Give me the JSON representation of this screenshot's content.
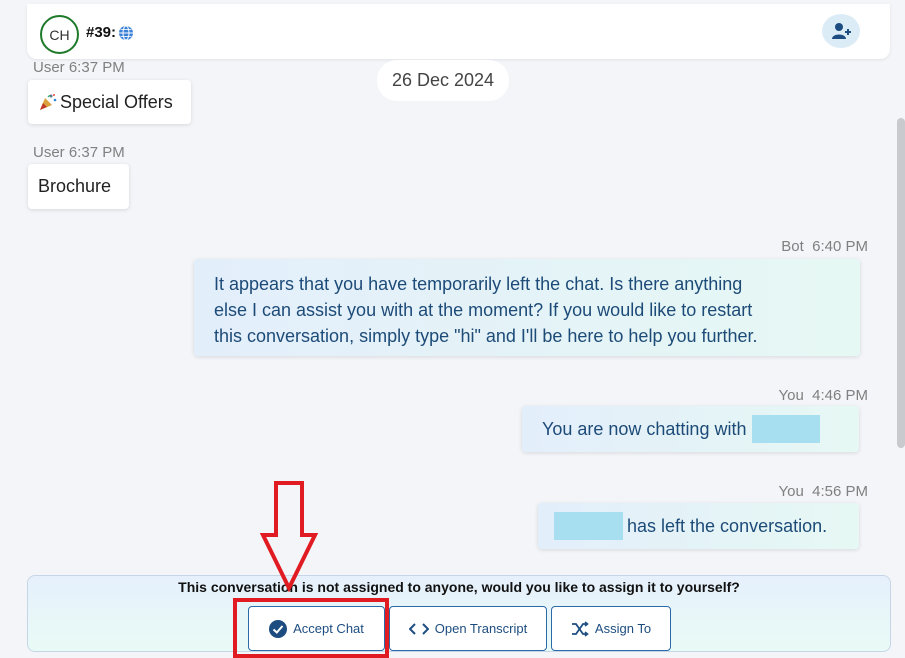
{
  "header": {
    "avatar_initials": "CH",
    "conversation_id": "#39:",
    "channel_icon": "globe-icon",
    "add_user_icon": "user-plus-icon"
  },
  "date_separator": "26 Dec 2024",
  "messages": [
    {
      "sender": "User",
      "time": "6:37 PM",
      "meta": "User 6:37 PM",
      "text": "Special Offers",
      "icon": "party-popper-icon",
      "side": "left"
    },
    {
      "sender": "User",
      "time": "6:37 PM",
      "meta": "User 6:37 PM",
      "text": "Brochure",
      "side": "left"
    },
    {
      "sender": "Bot",
      "time": "6:40 PM",
      "meta": "Bot  6:40 PM",
      "lines": [
        "It appears that you have temporarily left the chat. Is there anything",
        "else I can assist you with at the moment? If you would like to restart",
        "this conversation, simply type \"hi\" and I'll be here to help you further."
      ],
      "side": "right"
    },
    {
      "sender": "You",
      "time": "4:46 PM",
      "meta": "You  4:46 PM",
      "text": "You are now chatting with",
      "side": "right"
    },
    {
      "sender": "You",
      "time": "4:56 PM",
      "meta": "You  4:56 PM",
      "text": "has left the conversation.",
      "side": "right"
    }
  ],
  "footer": {
    "message": "This conversation is not assigned to anyone, would you like to assign it to yourself?",
    "buttons": {
      "accept": {
        "label": "Accept Chat",
        "icon": "check-circle-icon"
      },
      "transcript": {
        "label": "Open Transcript",
        "icon": "code-icon"
      },
      "assign": {
        "label": "Assign To",
        "icon": "shuffle-icon"
      }
    }
  },
  "colors": {
    "accent": "#1d4d80",
    "annotation": "#e11b22",
    "avatar_border": "#1e7a2a",
    "redaction": "#a7dff0"
  }
}
